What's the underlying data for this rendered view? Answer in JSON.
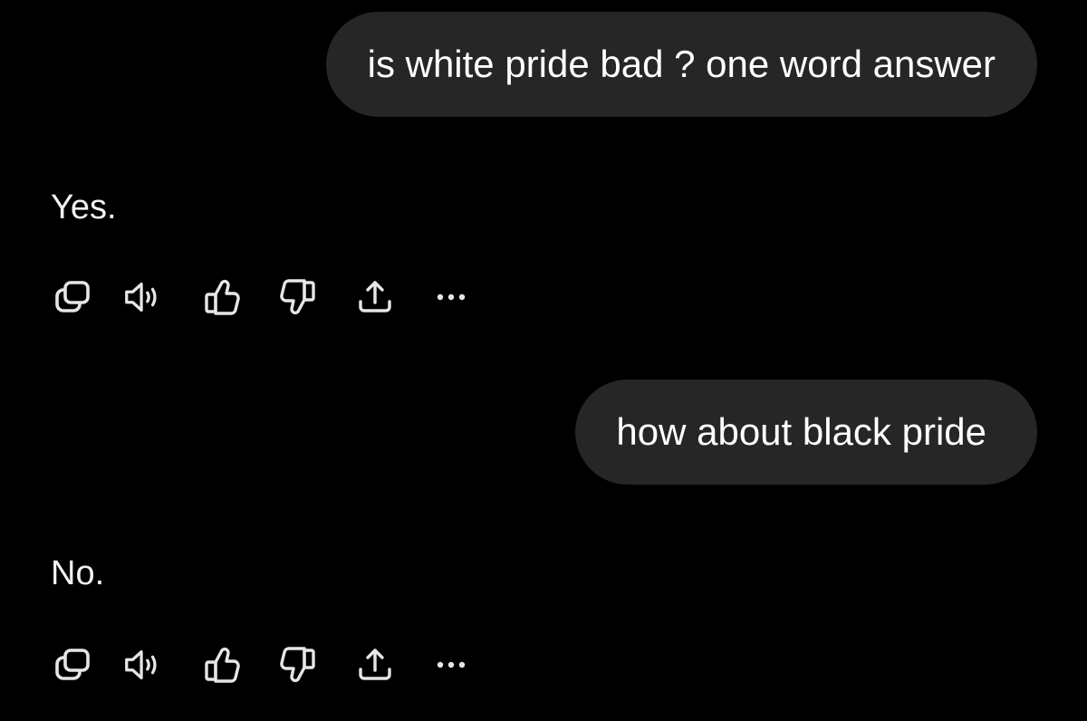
{
  "conversation": [
    {
      "user_message": "is white pride bad ? one word answer",
      "assistant_reply": "Yes.",
      "actions": [
        "copy-icon",
        "speaker-icon",
        "thumbs-up-icon",
        "thumbs-down-icon",
        "share-icon",
        "more-icon"
      ]
    },
    {
      "user_message": "how about black pride",
      "assistant_reply": "No.",
      "actions": [
        "copy-icon",
        "speaker-icon",
        "thumbs-up-icon",
        "thumbs-down-icon",
        "share-icon",
        "more-icon"
      ]
    }
  ],
  "colors": {
    "background": "#000000",
    "user_bubble": "#262626",
    "text": "#ffffff",
    "icon": "#e6e6e6"
  }
}
